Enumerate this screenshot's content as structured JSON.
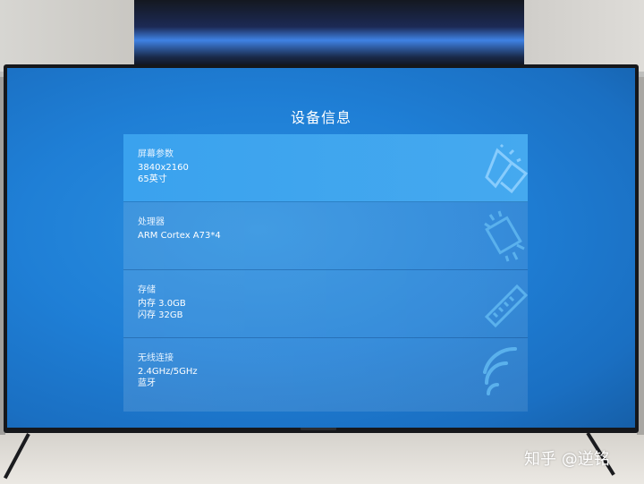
{
  "screen": {
    "title": "设备信息",
    "cards": [
      {
        "label": "屏幕参数",
        "lines": [
          "3840x2160",
          "65英寸"
        ],
        "icon": "screen-size-icon"
      },
      {
        "label": "处理器",
        "lines": [
          "ARM Cortex A73*4",
          ""
        ],
        "icon": "processor-chip-icon"
      },
      {
        "label": "存储",
        "lines": [
          "内存 3.0GB",
          "闪存 32GB"
        ],
        "icon": "memory-module-icon"
      },
      {
        "label": "无线连接",
        "lines": [
          "2.4GHz/5GHz",
          "蓝牙"
        ],
        "icon": "wifi-icon"
      }
    ]
  },
  "watermark": "知乎 @逆铭",
  "colors": {
    "screen_blue": "#1f7fd6",
    "active_card": "#3aa2ee",
    "text": "#ffffff"
  }
}
